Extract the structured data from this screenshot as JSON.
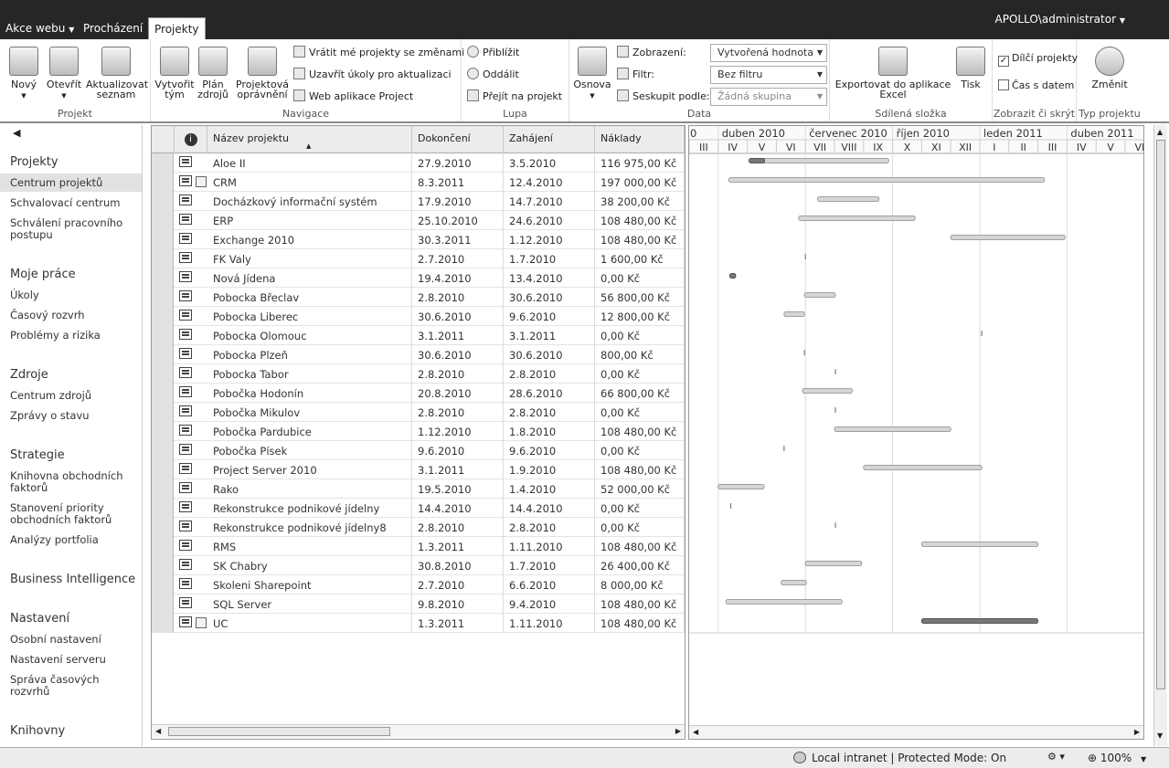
{
  "top": {
    "site_actions": "Akce webu",
    "tab_browse": "Procházení",
    "tab_projects": "Projekty",
    "user": "APOLLO\\administrator"
  },
  "ribbon": {
    "projekt": {
      "label": "Projekt",
      "new": "Nový",
      "open": "Otevřít",
      "refresh": "Aktualizovat seznam"
    },
    "navigace": {
      "label": "Navigace",
      "build_team": "Vytvořit tým",
      "resource_plan": "Plán zdrojů",
      "permissions": "Projektová oprávnění",
      "checkin": "Vrátit mé projekty se změnami",
      "close_tasks": "Uzavřít úkoly pro aktualizaci",
      "web_app": "Web aplikace Project"
    },
    "lupa": {
      "label": "Lupa",
      "zoom_in": "Přiblížit",
      "zoom_out": "Oddálit",
      "goto": "Přejít na projekt"
    },
    "data": {
      "label": "Data",
      "outline": "Osnova",
      "view_label": "Zobrazení:",
      "view_value": "Vytvořená hodnota",
      "filter_label": "Filtr:",
      "filter_value": "Bez filtru",
      "group_label": "Seskupit podle:",
      "group_value": "Žádná skupina"
    },
    "shared": {
      "label": "Sdílená složka",
      "export": "Exportovat do aplikace Excel",
      "print": "Tisk"
    },
    "show": {
      "label": "Zobrazit či skrýt",
      "subprojects": "Dílčí projekty",
      "subprojects_checked": true,
      "time_with_date": "Čas s datem",
      "time_with_date_checked": false
    },
    "type": {
      "label": "Typ projektu",
      "change": "Změnit"
    }
  },
  "nav": {
    "projekty": "Projekty",
    "centrum_projektu": "Centrum projektů",
    "schvalovaci": "Schvalovací centrum",
    "schvaleni": "Schválení pracovního postupu",
    "moje": "Moje práce",
    "ukoly": "Úkoly",
    "casovy": "Časový rozvrh",
    "problemy": "Problémy a rizika",
    "zdroje": "Zdroje",
    "centrum_zdroju": "Centrum zdrojů",
    "zpravy": "Zprávy o stavu",
    "strategie": "Strategie",
    "knihovna_faktoru": "Knihovna obchodních faktorů",
    "stanoveni": "Stanovení priority obchodních faktorů",
    "analyzy": "Analýzy portfolia",
    "bi": "Business Intelligence",
    "nastaveni": "Nastavení",
    "osobni": "Osobní nastavení",
    "serveru": "Nastavení serveru",
    "sprava": "Správa časových rozvrhů",
    "knihovny": "Knihovny"
  },
  "grid": {
    "columns": {
      "name": "Název projektu",
      "finish": "Dokončení",
      "start": "Zahájení",
      "cost": "Náklady"
    },
    "rows": [
      {
        "name": "Aloe II",
        "finish": "27.9.2010",
        "start": "3.5.2010",
        "cost": "116 975,00 Kč",
        "extra": false
      },
      {
        "name": "CRM",
        "finish": "8.3.2011",
        "start": "12.4.2010",
        "cost": "197 000,00 Kč",
        "extra": true
      },
      {
        "name": "Docházkový informační systém",
        "finish": "17.9.2010",
        "start": "14.7.2010",
        "cost": "38 200,00 Kč",
        "extra": false
      },
      {
        "name": "ERP",
        "finish": "25.10.2010",
        "start": "24.6.2010",
        "cost": "108 480,00 Kč",
        "extra": false
      },
      {
        "name": "Exchange 2010",
        "finish": "30.3.2011",
        "start": "1.12.2010",
        "cost": "108 480,00 Kč",
        "extra": false
      },
      {
        "name": "FK Valy",
        "finish": "2.7.2010",
        "start": "1.7.2010",
        "cost": "1 600,00 Kč",
        "extra": false
      },
      {
        "name": "Nová Jídena",
        "finish": "19.4.2010",
        "start": "13.4.2010",
        "cost": "0,00 Kč",
        "extra": false
      },
      {
        "name": "Pobocka Břeclav",
        "finish": "2.8.2010",
        "start": "30.6.2010",
        "cost": "56 800,00 Kč",
        "extra": false
      },
      {
        "name": "Pobocka Liberec",
        "finish": "30.6.2010",
        "start": "9.6.2010",
        "cost": "12 800,00 Kč",
        "extra": false
      },
      {
        "name": "Pobocka Olomouc",
        "finish": "3.1.2011",
        "start": "3.1.2011",
        "cost": "0,00 Kč",
        "extra": false
      },
      {
        "name": "Pobocka Plzeň",
        "finish": "30.6.2010",
        "start": "30.6.2010",
        "cost": "800,00 Kč",
        "extra": false
      },
      {
        "name": "Pobocka Tabor",
        "finish": "2.8.2010",
        "start": "2.8.2010",
        "cost": "0,00 Kč",
        "extra": false
      },
      {
        "name": "Pobočka Hodonín",
        "finish": "20.8.2010",
        "start": "28.6.2010",
        "cost": "66 800,00 Kč",
        "extra": false
      },
      {
        "name": "Pobočka Mikulov",
        "finish": "2.8.2010",
        "start": "2.8.2010",
        "cost": "0,00 Kč",
        "extra": false
      },
      {
        "name": "Pobočka Pardubice",
        "finish": "1.12.2010",
        "start": "1.8.2010",
        "cost": "108 480,00 Kč",
        "extra": false
      },
      {
        "name": "Pobočka Písek",
        "finish": "9.6.2010",
        "start": "9.6.2010",
        "cost": "0,00 Kč",
        "extra": false
      },
      {
        "name": "Project Server 2010",
        "finish": "3.1.2011",
        "start": "1.9.2010",
        "cost": "108 480,00 Kč",
        "extra": false
      },
      {
        "name": "Rako",
        "finish": "19.5.2010",
        "start": "1.4.2010",
        "cost": "52 000,00 Kč",
        "extra": false
      },
      {
        "name": "Rekonstrukce podnikové jídelny",
        "finish": "14.4.2010",
        "start": "14.4.2010",
        "cost": "0,00 Kč",
        "extra": false
      },
      {
        "name": "Rekonstrukce podnikové jídelny8",
        "finish": "2.8.2010",
        "start": "2.8.2010",
        "cost": "0,00 Kč",
        "extra": false
      },
      {
        "name": "RMS",
        "finish": "1.3.2011",
        "start": "1.11.2010",
        "cost": "108 480,00 Kč",
        "extra": false
      },
      {
        "name": "SK Chabry",
        "finish": "30.8.2010",
        "start": "1.7.2010",
        "cost": "26 400,00 Kč",
        "extra": false
      },
      {
        "name": "Skoleni Sharepoint",
        "finish": "2.7.2010",
        "start": "6.6.2010",
        "cost": "8 000,00 Kč",
        "extra": false
      },
      {
        "name": "SQL Server",
        "finish": "9.8.2010",
        "start": "9.4.2010",
        "cost": "108 480,00 Kč",
        "extra": false
      },
      {
        "name": "UC",
        "finish": "1.3.2011",
        "start": "1.11.2010",
        "cost": "108 480,00 Kč",
        "extra": true
      }
    ]
  },
  "gantt": {
    "quarters": [
      "0",
      "duben 2010",
      "červenec 2010",
      "říjen 2010",
      "leden 2011",
      "duben 2011"
    ],
    "months": [
      "III",
      "IV",
      "V",
      "VI",
      "VII",
      "VIII",
      "IX",
      "X",
      "XI",
      "XII",
      "I",
      "II",
      "III",
      "IV",
      "V",
      "VI"
    ],
    "dark_bars": [
      "Aloe II",
      "Nová Jídena",
      "UC"
    ]
  },
  "status": {
    "zone": "Local intranet | Protected Mode: On",
    "zoom": "100%"
  }
}
